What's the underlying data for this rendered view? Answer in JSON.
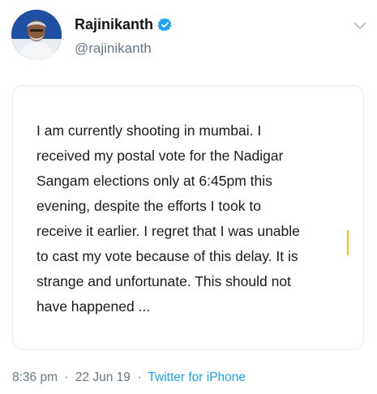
{
  "author": {
    "display_name": "Rajinikanth",
    "handle": "@rajinikanth",
    "verified": true,
    "avatar": "profile-photo"
  },
  "tweet": {
    "text": "I am currently shooting in mumbai.  I\nreceived my postal vote for the Nadigar\nSangam elections only at 6:45pm this\nevening, despite the efforts I took to\nreceive it earlier. I regret that I was unable\nto cast my vote because of this delay. It is\nstrange and unfortunate. This should not\nhave happened ..."
  },
  "meta": {
    "time": "8:36 pm",
    "separator": "·",
    "date": "22 Jun 19",
    "source": "Twitter for iPhone"
  },
  "colors": {
    "verified_badge": "#1da1f2",
    "link": "#1da1f2",
    "muted_text": "#657786",
    "cursor_highlight": "#f2c21a"
  },
  "icons": {
    "verified": "verified-badge-icon",
    "menu": "chevron-down-icon"
  }
}
